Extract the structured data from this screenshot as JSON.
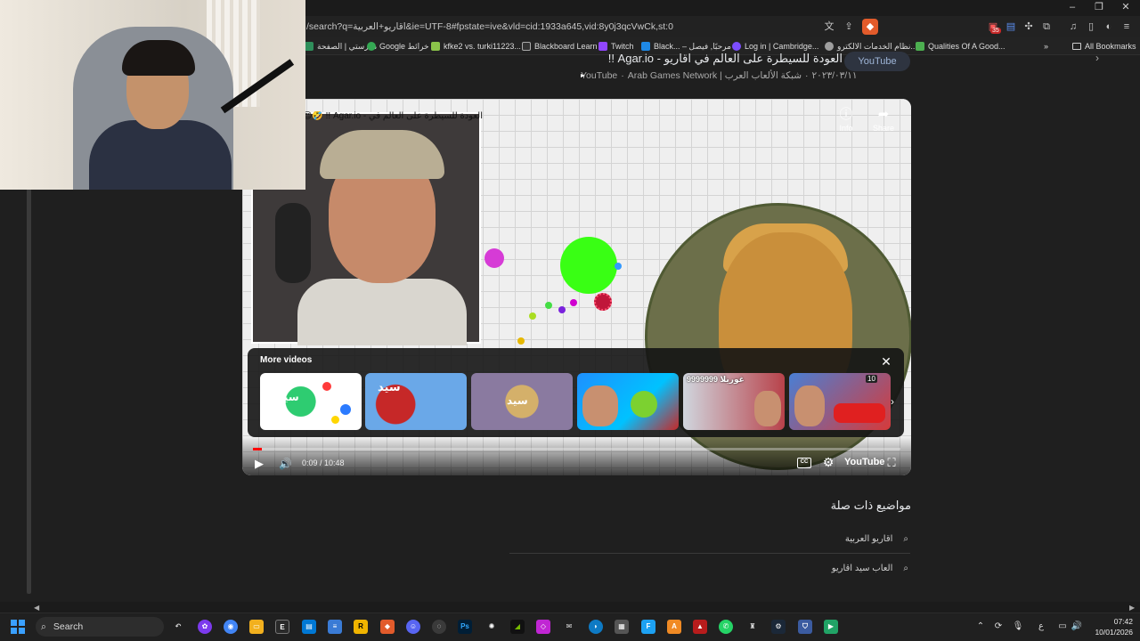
{
  "browser": {
    "url": "/search?q=اقاريو+العربية&ie=UTF-8#fpstate=ive&vld=cid:1933a645,vid:8y0j3qcVwCk,st:0",
    "bookmarks": [
      {
        "label": "مدرستي | الصفحة"
      },
      {
        "label": "Google خرائط"
      },
      {
        "label": "kfke2 vs. turki11223..."
      },
      {
        "label": "Blackboard Learn"
      },
      {
        "label": "Twitch"
      },
      {
        "label": "Black... – مرحبًا, فيصل"
      },
      {
        "label": "Log in | Cambridge..."
      },
      {
        "label": "نظام الخدمات الالكترو..."
      },
      {
        "label": "Qualities Of A Good..."
      }
    ],
    "all_bookmarks": "All Bookmarks",
    "window_controls": {
      "minimize": "–",
      "restore": "❐",
      "close": "✕"
    },
    "extension_badge": "35"
  },
  "video": {
    "title": "العودة للسيطرة على العالم في اقاريو - Agar.io !!",
    "source_platform": "YouTube",
    "channel": "Arab Games Network | شبكة الألعاب العرب",
    "date": "٢٠٢٣/٠٣/١١",
    "youtube_button": "YouTube",
    "player_title": "العودة للسيطرة على العالم في - Agar.io !! 🤣😍",
    "info_label": "Info",
    "share_label": "Share",
    "more_videos_label": "More videos",
    "time": "0:09 / 10:48",
    "progress": 0.014,
    "yt_wordmark": "YouTube",
    "cc_label": "CC",
    "thumbnails": [
      {
        "text": "سيد",
        "color": "#ffffff"
      },
      {
        "text": "سيد",
        "color": "#3a7bd5"
      },
      {
        "text": "سيد",
        "color": "#7a6a8a"
      },
      {
        "text": "",
        "color": "#1e90ff"
      },
      {
        "text": "غوريلا 9999999",
        "color": "#d83a3a"
      },
      {
        "text": "10",
        "color": "#3b6fd0"
      }
    ]
  },
  "related": {
    "title": "مواضيع ذات صلة",
    "items": [
      {
        "label": "اقاريو العربية"
      },
      {
        "label": "العاب سيد اقاريو"
      }
    ]
  },
  "taskbar": {
    "search_placeholder": "Search",
    "time": "07:42",
    "date": "10/01/2026",
    "lang": "ع"
  },
  "colors": {
    "accent": "#ff0000",
    "page_bg": "#1f1f1f",
    "agar_green": "#39ff14"
  }
}
